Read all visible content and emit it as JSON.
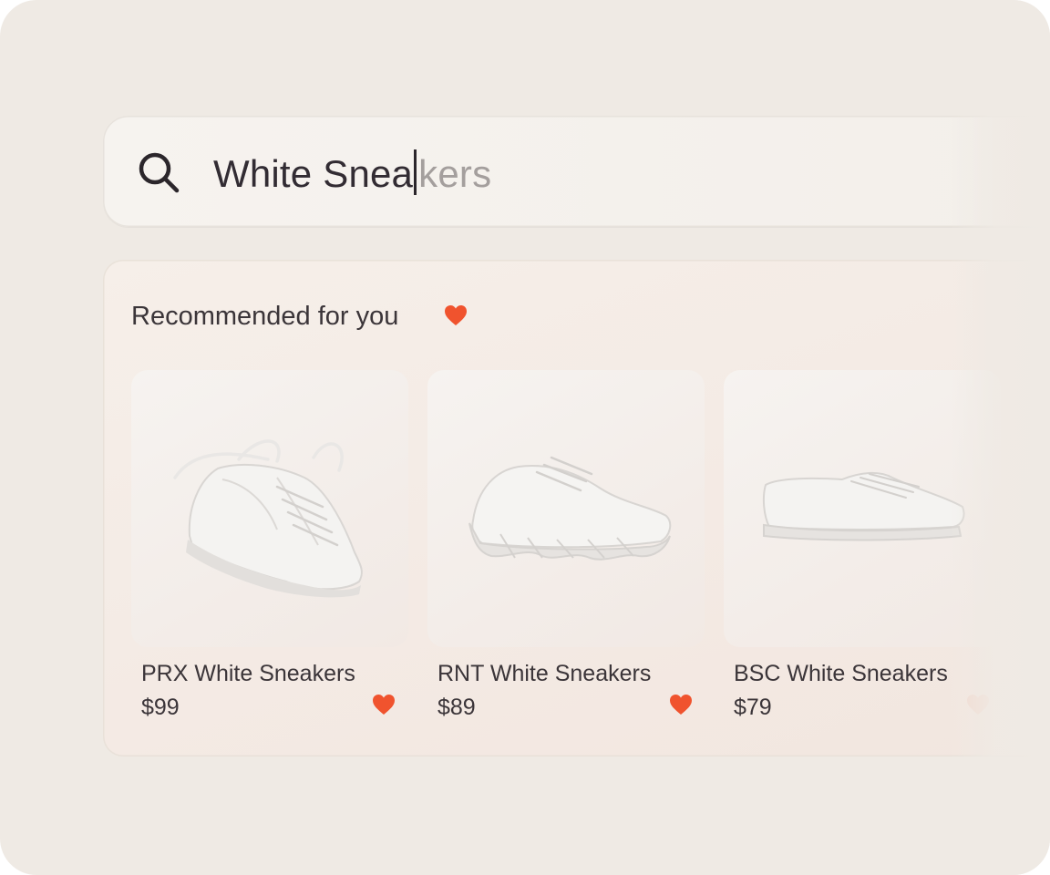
{
  "search": {
    "typed_text": "White Snea",
    "suggestion_text": "kers"
  },
  "recommendations": {
    "title": "Recommended for you",
    "title_icon": "heart-icon",
    "products": [
      {
        "name": "PRX White Sneakers",
        "price": "$99",
        "favorite": true,
        "image": "white-high-top-sneaker-with-flying-laces"
      },
      {
        "name": "RNT White Sneakers",
        "price": "$89",
        "favorite": true,
        "image": "white-chunky-running-sneaker"
      },
      {
        "name": "BSC White Sneakers",
        "price": "$79",
        "favorite": false,
        "image": "white-low-top-canvas-sneaker"
      }
    ]
  },
  "colors": {
    "accent_heart": "#f0532e",
    "background": "#efeae4",
    "text": "#3b3539"
  }
}
